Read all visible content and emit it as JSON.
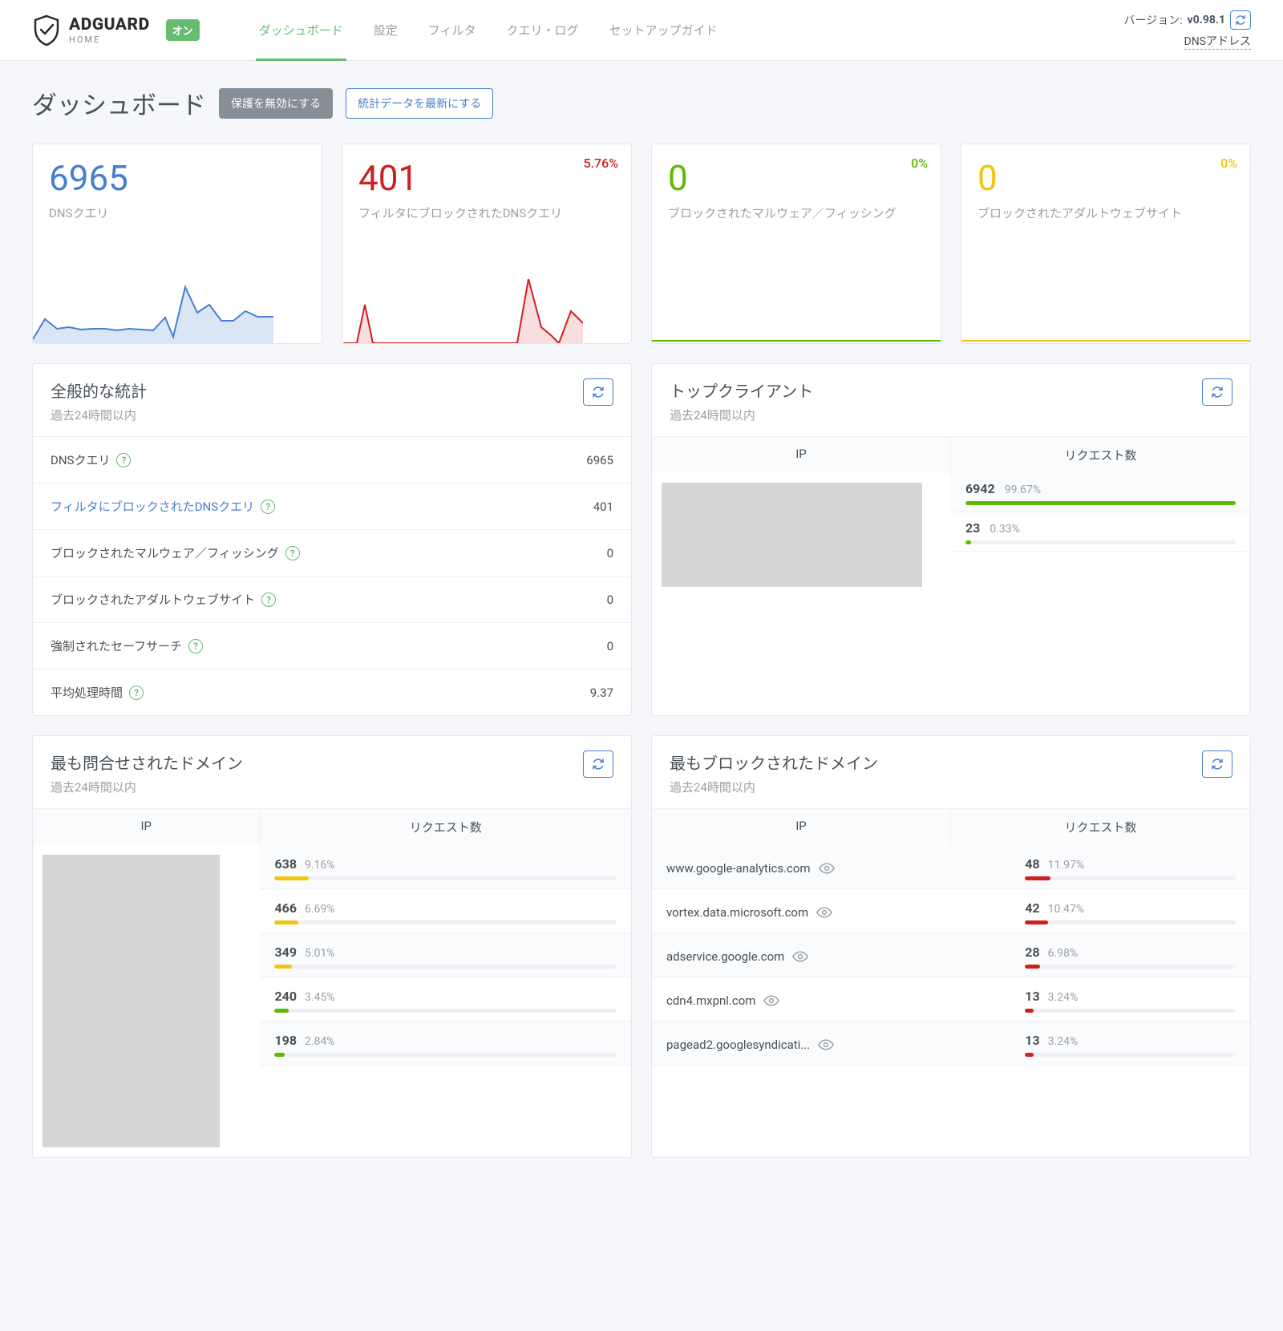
{
  "header": {
    "brand": "ADGUARD",
    "brand_sub": "HOME",
    "status_badge": "オン",
    "nav": [
      "ダッシュボード",
      "設定",
      "フィルタ",
      "クエリ・ログ",
      "セットアップガイド"
    ],
    "version_label": "バージョン: ",
    "version_value": "v0.98.1",
    "dns_link": "DNSアドレス"
  },
  "page": {
    "title": "ダッシュボード",
    "btn_disable": "保護を無効にする",
    "btn_refresh": "統計データを最新にする"
  },
  "stats": [
    {
      "num": "6965",
      "label": "DNSクエリ",
      "pct": "",
      "color": "#467fcf"
    },
    {
      "num": "401",
      "label": "フィルタにブロックされたDNSクエリ",
      "pct": "5.76%",
      "color": "#cd201f"
    },
    {
      "num": "0",
      "label": "ブロックされたマルウェア／フィッシング",
      "pct": "0%",
      "color": "#5eba00"
    },
    {
      "num": "0",
      "label": "ブロックされたアダルトウェブサイト",
      "pct": "0%",
      "color": "#f1c40f"
    }
  ],
  "panels": {
    "general": {
      "title": "全般的な統計",
      "subtitle": "過去24時間以内",
      "rows": [
        {
          "label": "DNSクエリ",
          "value": "6965",
          "link": false
        },
        {
          "label": "フィルタにブロックされたDNSクエリ",
          "value": "401",
          "link": true
        },
        {
          "label": "ブロックされたマルウェア／フィッシング",
          "value": "0",
          "link": false
        },
        {
          "label": "ブロックされたアダルトウェブサイト",
          "value": "0",
          "link": false
        },
        {
          "label": "強制されたセーフサーチ",
          "value": "0",
          "link": false
        },
        {
          "label": "平均処理時間",
          "value": "9.37",
          "link": false
        }
      ]
    },
    "clients": {
      "title": "トップクライアント",
      "subtitle": "過去24時間以内",
      "col1": "IP",
      "col2": "リクエスト数",
      "rows": [
        {
          "count": "6942",
          "pct": "99.67%",
          "width": 100,
          "color": "#5eba00"
        },
        {
          "count": "23",
          "pct": "0.33%",
          "width": 2,
          "color": "#5eba00"
        }
      ]
    },
    "queried": {
      "title": "最も問合せされたドメイン",
      "subtitle": "過去24時間以内",
      "col1": "IP",
      "col2": "リクエスト数",
      "rows": [
        {
          "count": "638",
          "pct": "9.16%",
          "width": 10,
          "color": "#f1c40f"
        },
        {
          "count": "466",
          "pct": "6.69%",
          "width": 7,
          "color": "#f1c40f"
        },
        {
          "count": "349",
          "pct": "5.01%",
          "width": 5,
          "color": "#f1c40f"
        },
        {
          "count": "240",
          "pct": "3.45%",
          "width": 4,
          "color": "#5eba00"
        },
        {
          "count": "198",
          "pct": "2.84%",
          "width": 3,
          "color": "#5eba00"
        }
      ]
    },
    "blocked": {
      "title": "最もブロックされたドメイン",
      "subtitle": "過去24時間以内",
      "col1": "IP",
      "col2": "リクエスト数",
      "rows": [
        {
          "domain": "www.google-analytics.com",
          "count": "48",
          "pct": "11.97%",
          "width": 12,
          "color": "#cd201f"
        },
        {
          "domain": "vortex.data.microsoft.com",
          "count": "42",
          "pct": "10.47%",
          "width": 11,
          "color": "#cd201f"
        },
        {
          "domain": "adservice.google.com",
          "count": "28",
          "pct": "6.98%",
          "width": 7,
          "color": "#cd201f"
        },
        {
          "domain": "cdn4.mxpnl.com",
          "count": "13",
          "pct": "3.24%",
          "width": 4,
          "color": "#cd201f"
        },
        {
          "domain": "pagead2.googlesyndicati...",
          "count": "13",
          "pct": "3.24%",
          "width": 4,
          "color": "#cd201f"
        }
      ]
    }
  },
  "chart_data": [
    {
      "type": "area",
      "title": "DNSクエリ",
      "values": [
        5,
        30,
        18,
        20,
        17,
        18,
        18,
        16,
        18,
        17,
        16,
        32,
        8,
        70,
        38,
        48,
        28,
        28,
        40,
        33
      ],
      "ylim": [
        0,
        80
      ],
      "color": "#467fcf"
    },
    {
      "type": "area",
      "title": "フィルタにブロックされたDNSクエリ",
      "values": [
        0,
        0,
        48,
        0,
        0,
        0,
        0,
        0,
        0,
        0,
        0,
        0,
        0,
        0,
        0,
        80,
        20,
        10,
        0,
        40
      ],
      "ylim": [
        0,
        80
      ],
      "color": "#cd201f"
    }
  ]
}
